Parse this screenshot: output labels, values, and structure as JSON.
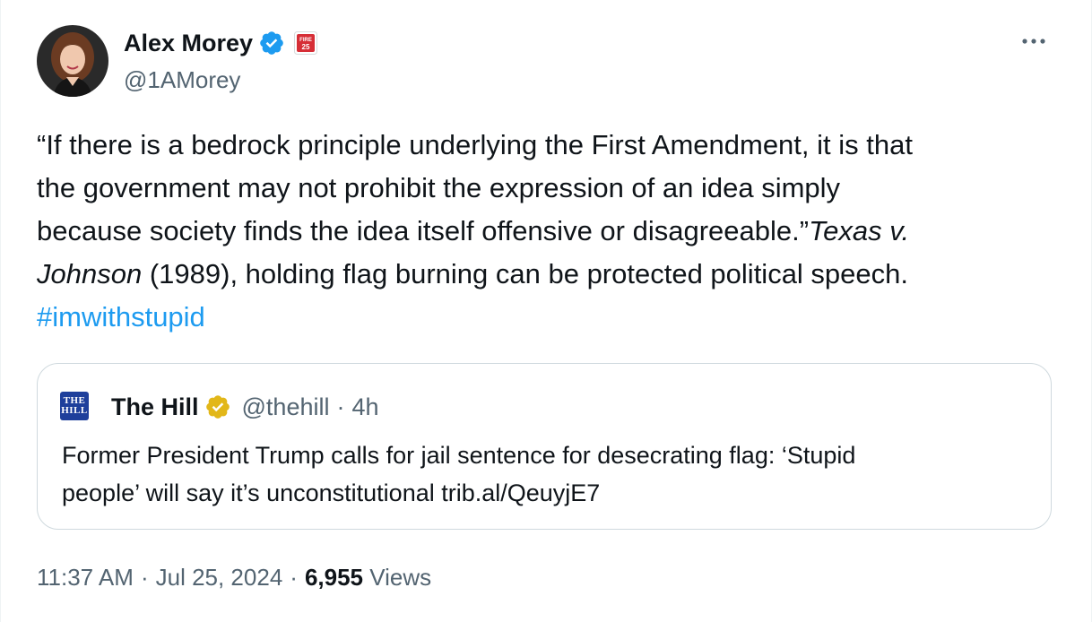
{
  "author": {
    "name": "Alex Morey",
    "handle": "@1AMorey",
    "affiliation_badge_text": [
      "FIRE",
      "25"
    ]
  },
  "tweet": {
    "lines": [
      "“If there is a bedrock principle underlying the First Amendment, it is that",
      "the government may not prohibit the expression of an idea simply",
      "because society finds the idea itself offensive or disagreeable.”"
    ],
    "italic_case_1": "Texas v.",
    "italic_case_2": "Johnson",
    "after_case": " (1989), holding flag burning can be protected political speech.",
    "hashtag": "#imwithstupid"
  },
  "quote": {
    "logo_text": [
      "THE",
      "HILL"
    ],
    "name": "The Hill",
    "handle": "@thehill",
    "separator": "·",
    "time": "4h",
    "lines": [
      "Former President Trump calls for jail sentence for desecrating flag: ‘Stupid",
      "people’ will say it’s unconstitutional trib.al/QeuyjE7"
    ]
  },
  "meta": {
    "time": "11:37 AM",
    "date": "Jul 25, 2024",
    "separator": "·",
    "views_count": "6,955",
    "views_label": "Views"
  },
  "colors": {
    "text_primary": "#0f1419",
    "text_secondary": "#536471",
    "link": "#1d9bf0",
    "verified_blue": "#1d9bf0",
    "verified_gold": "#e2b719",
    "border": "#cfd9de",
    "hill_blue": "#1e3f9b",
    "fire_red": "#d62e36"
  },
  "icons": {
    "verified": "verified-badge-icon",
    "affiliation": "fire-affiliate-badge-icon",
    "more": "more-options-icon",
    "gold_verified": "gold-verified-badge-icon"
  }
}
